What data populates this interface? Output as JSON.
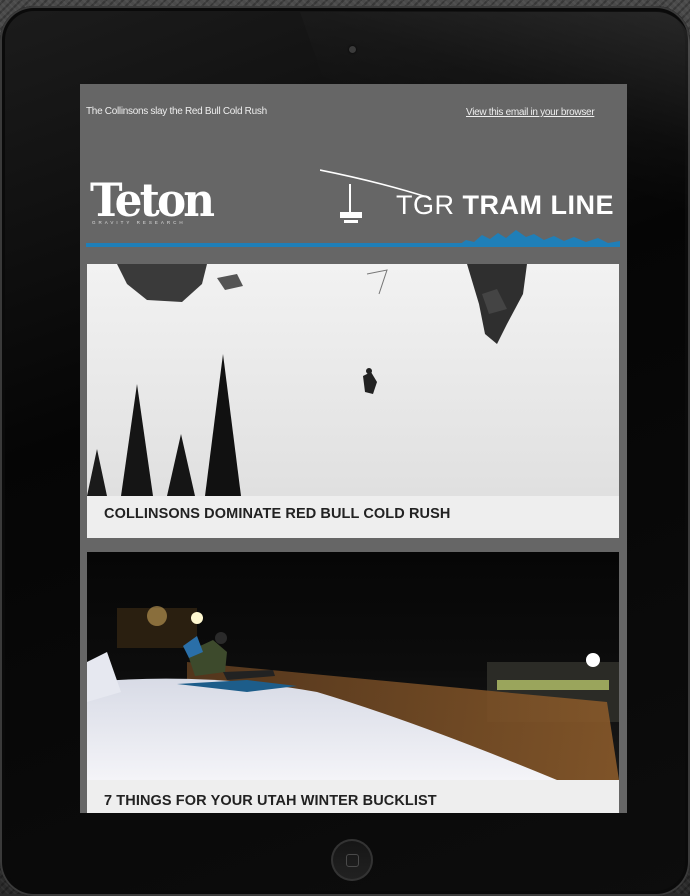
{
  "email": {
    "preheader": "The Collinsons slay the Red Bull Cold Rush",
    "view_in_browser": "View this email in your browser"
  },
  "header": {
    "brand_logo_text": "Teton",
    "brand_logo_subtext": "GRAVITY RESEARCH",
    "newsletter_prefix": "TGR",
    "newsletter_name": "TRAM LINE"
  },
  "stories": [
    {
      "title": "COLLINSONS DOMINATE RED BULL COLD RUSH"
    },
    {
      "title": "7 THINGS FOR YOUR UTAH WINTER BUCKLIST"
    }
  ],
  "colors": {
    "email_background": "#666666",
    "accent_blue": "#1f7fb8",
    "card_background": "#eeeeee"
  }
}
